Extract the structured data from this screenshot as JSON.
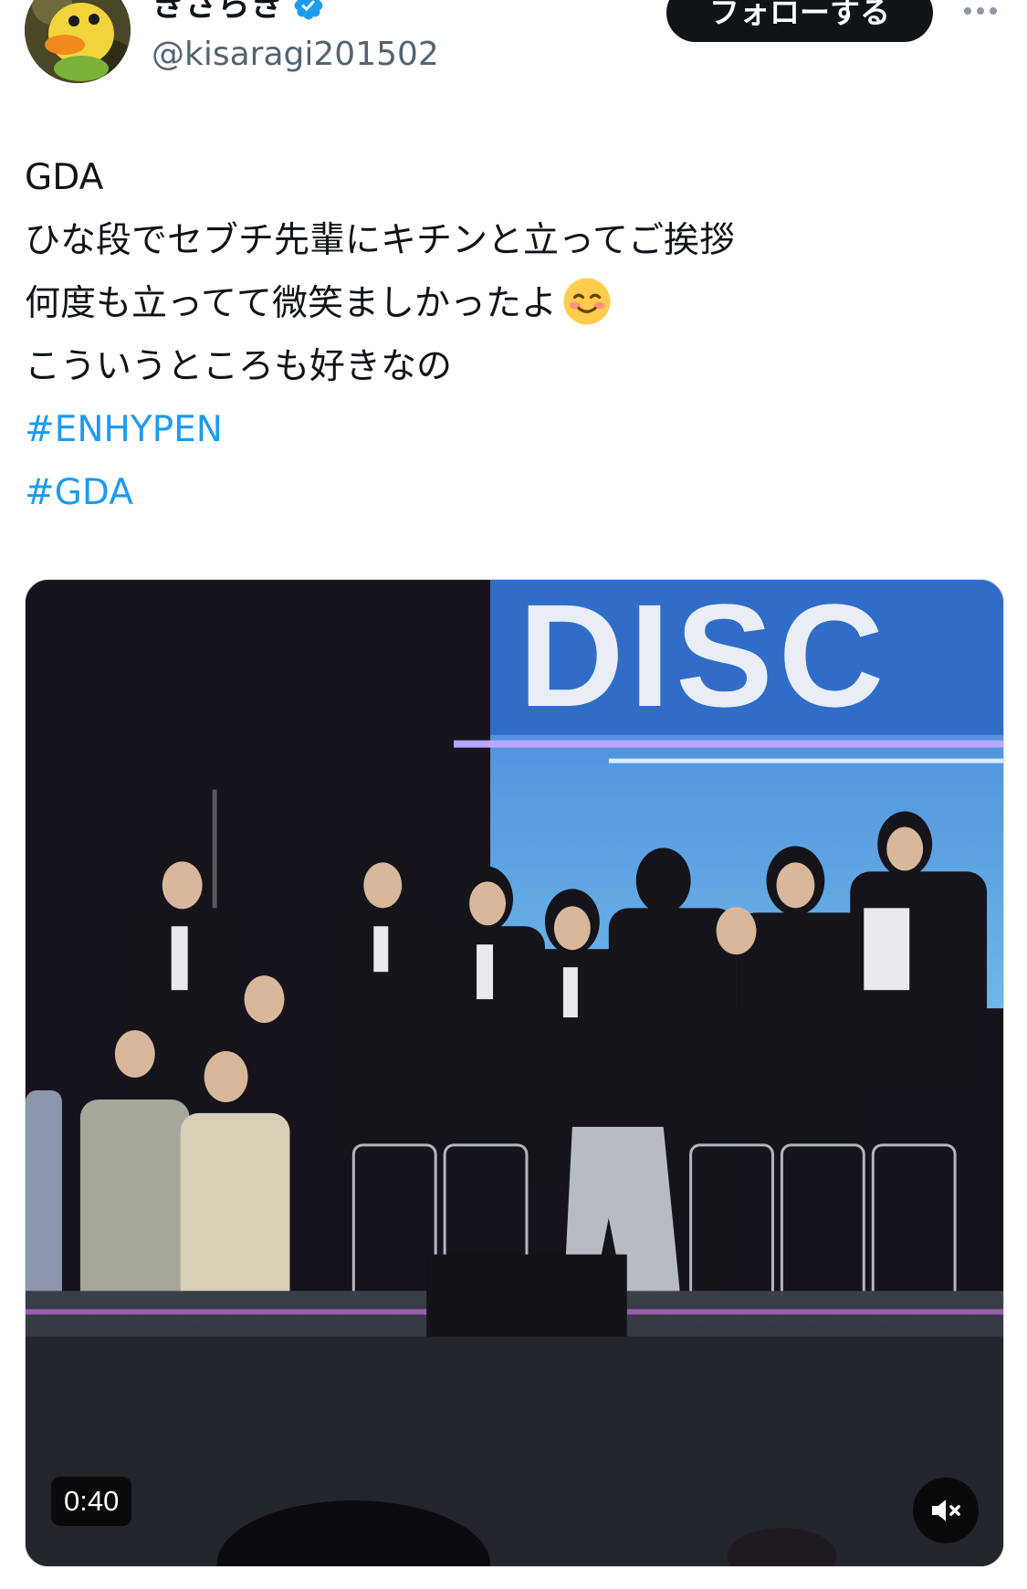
{
  "author": {
    "display_name": "きさらき",
    "handle": "@kisaragi201502",
    "verified_icon": "verified-badge-icon",
    "avatar_icon": "duck-avatar"
  },
  "header": {
    "follow_label": "フォローする",
    "more_icon": "more-icon"
  },
  "tweet": {
    "lines": [
      "GDA",
      "ひな段でセブチ先輩にキチンと立ってご挨拶",
      "何度も立ってて微笑ましかったよ",
      "こういうところも好きなの"
    ],
    "emoji": "☺️",
    "hashtags": [
      "#ENHYPEN",
      "#GDA"
    ]
  },
  "video": {
    "screen_text": "DISC",
    "duration": "0:40",
    "mute_icon": "mute-icon"
  },
  "colors": {
    "text": "#0f1419",
    "secondary": "#536471",
    "link": "#1d9bf0",
    "verified": "#1d9bf0",
    "follow_bg": "#0f1419"
  }
}
